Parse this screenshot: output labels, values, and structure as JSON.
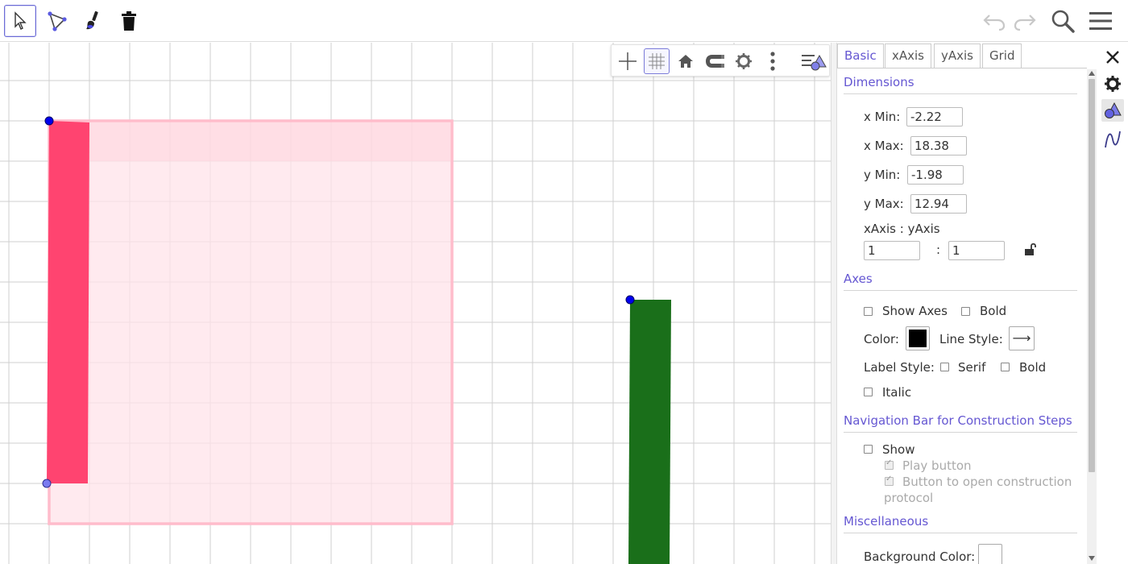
{
  "toolbar": {
    "tools": [
      {
        "name": "move-tool",
        "icon": "cursor-arrow-icon",
        "active": true
      },
      {
        "name": "polygon-tool",
        "icon": "triangle-points-icon",
        "active": false
      },
      {
        "name": "style-brush-tool",
        "icon": "paint-brush-icon",
        "active": false
      },
      {
        "name": "delete-tool",
        "icon": "trash-icon",
        "active": false
      }
    ],
    "right_buttons": [
      "undo-icon",
      "redo-icon",
      "search-icon",
      "menu-icon"
    ]
  },
  "stylebar": {
    "buttons": [
      "show-axes-icon",
      "show-grid-icon",
      "home-icon",
      "snap-magnet-icon",
      "settings-gear-icon",
      "more-vertical-icon",
      "toggle-panel-icon"
    ],
    "grid_on": true
  },
  "colors": {
    "accent": "#6557d2",
    "pink_fill": "#ff4d73",
    "pink_light": "#ffcfd9",
    "green_fill": "#1a6f1a",
    "point_blue": "#0000ff"
  },
  "properties": {
    "tabs": [
      "Basic",
      "xAxis",
      "yAxis",
      "Grid"
    ],
    "selected_tab": "Basic",
    "dimensions": {
      "title": "Dimensions",
      "xmin_label": "x Min:",
      "xmin_value": "-2.22",
      "xmax_label": "x Max:",
      "xmax_value": "18.38",
      "ymin_label": "y Min:",
      "ymin_value": "-1.98",
      "ymax_label": "y Max:",
      "ymax_value": "12.94",
      "ratio_label": "xAxis : yAxis",
      "ratio_x": "1",
      "ratio_sep": ":",
      "ratio_y": "1"
    },
    "axes": {
      "title": "Axes",
      "show_axes": "Show Axes",
      "bold": "Bold",
      "color_label": "Color:",
      "color_value": "#000000",
      "line_style_label": "Line Style:",
      "line_style_glyph": "⟶",
      "label_style": "Label Style:",
      "serif": "Serif",
      "bold2": "Bold",
      "italic": "Italic"
    },
    "navigation": {
      "title": "Navigation Bar for Construction Steps",
      "show": "Show",
      "play_button": "Play button",
      "open_protocol_line1": "Button to open construction",
      "open_protocol_line2": "protocol"
    },
    "misc": {
      "title": "Miscellaneous",
      "bg_color_label": "Background Color:",
      "bg_color_value": "#ffffff"
    }
  }
}
